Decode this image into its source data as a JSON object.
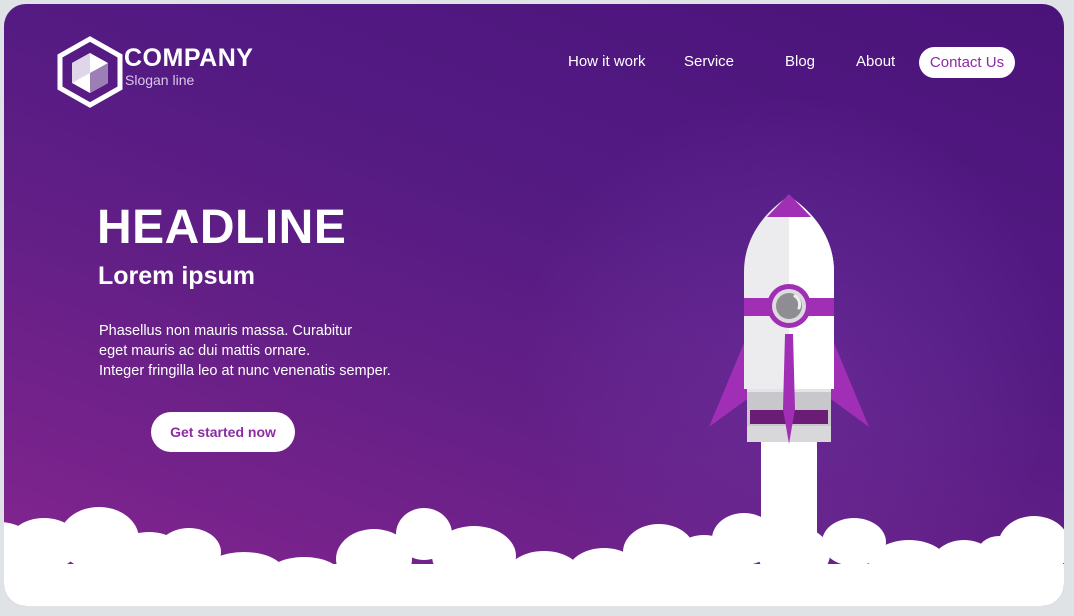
{
  "brand": {
    "name": "COMPANY",
    "slogan": "Slogan line",
    "logo_icon": "hexagon-cube-icon"
  },
  "nav": {
    "items": [
      {
        "label": "How it work"
      },
      {
        "label": "Service"
      },
      {
        "label": "Blog"
      },
      {
        "label": "About"
      }
    ],
    "contact_label": "Contact Us"
  },
  "hero": {
    "headline": "HEADLINE",
    "subheadline": "Lorem ipsum",
    "body_lines": [
      "Phasellus non mauris massa.  Curabitur",
      "eget mauris ac dui mattis ornare.",
      "Integer fringilla leo at nunc venenatis semper."
    ],
    "cta_label": "Get started now"
  },
  "illustration": {
    "rocket_icon": "rocket-icon",
    "clouds_icon": "clouds-icon"
  },
  "colors": {
    "background_dark": "#4a137a",
    "background_light": "#872590",
    "accent": "#8e2aa5",
    "rocket_purple": "#a02fb5",
    "white": "#ffffff"
  }
}
